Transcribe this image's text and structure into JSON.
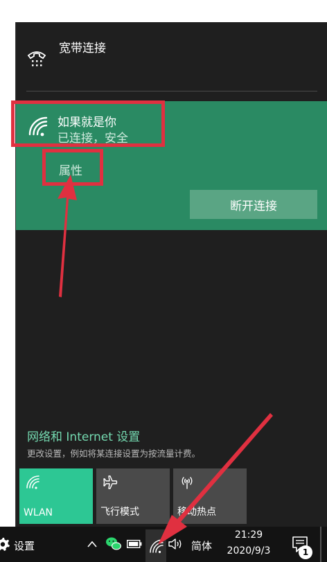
{
  "broadband": {
    "label": "宽带连接",
    "icon": "dialup-phone-icon"
  },
  "wifi": {
    "ssid": "如果就是你",
    "status": "已连接，安全",
    "properties_label": "属性",
    "disconnect_label": "断开连接",
    "card_color": "#2a8a63"
  },
  "settings": {
    "link_label": "网络和 Internet 设置",
    "description": "更改设置，例如将某连接设置为按流量计费。"
  },
  "quick_actions": [
    {
      "label": "WLAN",
      "icon": "wifi-icon",
      "active": true
    },
    {
      "label": "飞行模式",
      "icon": "airplane-icon",
      "active": false
    },
    {
      "label": "移动热点",
      "icon": "hotspot-icon",
      "active": false
    }
  ],
  "taskbar": {
    "settings_label": "设置",
    "ime_label": "简体",
    "time": "21:29",
    "date": "2020/9/3",
    "notification_count": "1"
  },
  "colors": {
    "accent": "#2dc794",
    "annotation": "#e03040"
  }
}
